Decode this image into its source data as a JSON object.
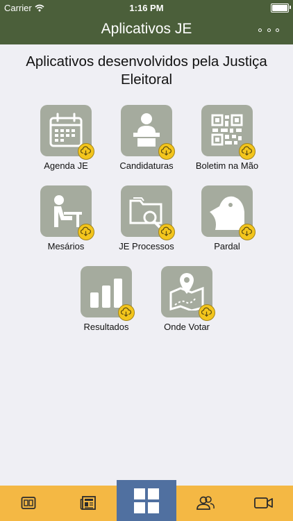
{
  "status_bar": {
    "carrier": "Carrier",
    "time": "1:16 PM"
  },
  "header": {
    "title": "Aplicativos JE",
    "more_icon": "more-horizontal-icon"
  },
  "main": {
    "heading": "Aplicativos desenvolvidos pela Justiça Eleitoral",
    "apps": [
      {
        "label": "Agenda JE",
        "icon": "calendar-icon"
      },
      {
        "label": "Candidaturas",
        "icon": "candidate-podium-icon"
      },
      {
        "label": "Boletim na Mão",
        "icon": "qr-code-icon"
      },
      {
        "label": "Mesários",
        "icon": "poll-worker-desk-icon"
      },
      {
        "label": "JE Processos",
        "icon": "folder-search-icon"
      },
      {
        "label": "Pardal",
        "icon": "bird-icon"
      },
      {
        "label": "Resultados",
        "icon": "bar-chart-icon"
      },
      {
        "label": "Onde Votar",
        "icon": "map-pin-icon"
      }
    ],
    "badge_icon": "cloud-download-icon"
  },
  "tab_bar": {
    "tabs": [
      {
        "icon": "tablet-icon",
        "active": false
      },
      {
        "icon": "newspaper-icon",
        "active": false
      },
      {
        "icon": "apps-grid-icon",
        "active": true
      },
      {
        "icon": "people-icon",
        "active": false
      },
      {
        "icon": "video-camera-icon",
        "active": false
      }
    ]
  },
  "colors": {
    "header_bg": "#4b5f3a",
    "tile_bg": "#a5ab9e",
    "badge": "#f3c51c",
    "tab_bar_bg": "#f4b844",
    "tab_active_bg": "#5070a0",
    "background": "#efeff4"
  }
}
